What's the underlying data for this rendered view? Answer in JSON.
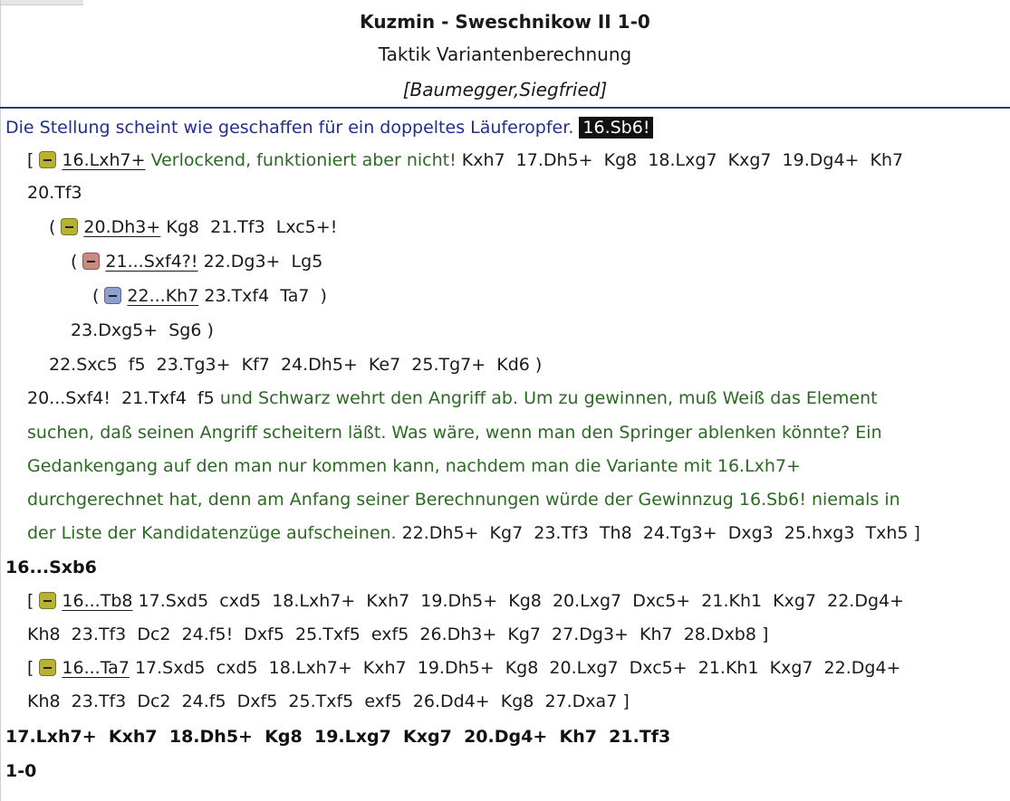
{
  "header": {
    "title": "Kuzmin - Sweschnikow II  1-0",
    "subtitle": "Taktik Variantenberechnung",
    "author": "[Baumegger,Siegfried]"
  },
  "colors": {
    "comment_blue": "#1f2e8f",
    "comment_green": "#2b6a22",
    "separator": "#243c72",
    "marker_olive": "#b8b232",
    "marker_rose": "#c98b7e",
    "marker_lavender": "#8d9fcf"
  },
  "lines": {
    "l1": {
      "comment": "Die Stellung scheint wie geschaffen für ein doppeltes Läuferopfer.",
      "highlight": "16.Sb6!"
    },
    "l2": {
      "open": "[",
      "head": "16.Lxh7+",
      "comment": "Verlockend, funktioniert aber nicht!",
      "moves": "Kxh7  17.Dh5+  Kg8  18.Lxg7  Kxg7  19.Dg4+  Kh7"
    },
    "l3": {
      "moves": "20.Tf3"
    },
    "l4": {
      "open": "(",
      "head": "20.Dh3+",
      "moves": "Kg8  21.Tf3  Lxc5+!"
    },
    "l5": {
      "open": "(",
      "head": "21...Sxf4?!",
      "moves": "22.Dg3+  Lg5"
    },
    "l6": {
      "open": "(",
      "head": "22...Kh7",
      "moves": "23.Txf4  Ta7  )"
    },
    "l7": {
      "moves": "23.Dxg5+  Sg6 )"
    },
    "l8": {
      "moves": "22.Sxc5  f5  23.Tg3+  Kf7  24.Dh5+  Ke7  25.Tg7+  Kd6 )"
    },
    "l9": {
      "moves": "20...Sxf4!  21.Txf4  f5",
      "comment": "und Schwarz wehrt den Angriff ab. Um zu gewinnen, muß Weiß das Element"
    },
    "l10": {
      "comment": "suchen, daß seinen Angriff scheitern läßt. Was wäre, wenn man den Springer ablenken könnte? Ein"
    },
    "l11": {
      "comment": "Gedankengang auf den man nur kommen kann, nachdem man die Variante mit 16.Lxh7+"
    },
    "l12": {
      "comment": "durchgerechnet hat, denn am Anfang seiner Berechnungen würde der Gewinnzug 16.Sb6! niemals in"
    },
    "l13": {
      "comment": "der Liste der Kandidatenzüge aufscheinen.",
      "moves": "22.Dh5+  Kg7  23.Tf3  Th8  24.Tg3+  Dxg3  25.hxg3  Txh5 ]"
    },
    "l14": {
      "main": "16...Sxb6"
    },
    "l15": {
      "open": "[",
      "head": "16...Tb8",
      "moves": "17.Sxd5  cxd5  18.Lxh7+  Kxh7  19.Dh5+  Kg8  20.Lxg7  Dxc5+  21.Kh1  Kxg7  22.Dg4+"
    },
    "l16": {
      "moves": "Kh8  23.Tf3  Dc2  24.f5!  Dxf5  25.Txf5  exf5  26.Dh3+  Kg7  27.Dg3+  Kh7  28.Dxb8 ]"
    },
    "l17": {
      "open": "[",
      "head": "16...Ta7",
      "moves": "17.Sxd5  cxd5  18.Lxh7+  Kxh7  19.Dh5+  Kg8  20.Lxg7  Dxc5+  21.Kh1  Kxg7  22.Dg4+"
    },
    "l18": {
      "moves": "Kh8  23.Tf3  Dc2  24.f5  Dxf5  25.Txf5  exf5  26.Dd4+  Kg8  27.Dxa7 ]"
    },
    "l19": {
      "main": "17.Lxh7+  Kxh7  18.Dh5+  Kg8  19.Lxg7  Kxg7  20.Dg4+  Kh7  21.Tf3"
    },
    "l20": {
      "main": "1-0"
    }
  }
}
